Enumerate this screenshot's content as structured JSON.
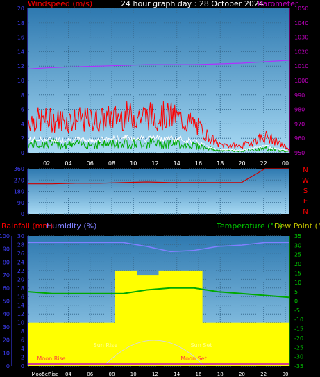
{
  "header": {
    "left_title": "Windspeed (m/s)",
    "center_title": "24 hour graph day : 28 October 2024",
    "right_title": "Barometer (hpa)"
  },
  "x_axis": {
    "ticks": [
      "02",
      "04",
      "06",
      "08",
      "10",
      "12",
      "14",
      "16",
      "18",
      "20",
      "22",
      "00"
    ],
    "bottom_ticks": [
      "Moon",
      "Set",
      "Rise",
      "04",
      "06",
      "08",
      "10",
      "12",
      "14",
      "16",
      "18",
      "20",
      "22",
      "00"
    ]
  },
  "panel_wind": {
    "y_left_ticks": [
      "0",
      "2",
      "4",
      "6",
      "8",
      "10",
      "12",
      "14",
      "16",
      "18",
      "20"
    ],
    "y_right_ticks": [
      "950",
      "960",
      "970",
      "980",
      "990",
      "1000",
      "1010",
      "1020",
      "1030",
      "1040",
      "1050"
    ]
  },
  "panel_dir": {
    "y_left_ticks": [
      "0",
      "90",
      "180",
      "270",
      "360"
    ],
    "compass": [
      "N",
      "W",
      "S",
      "E",
      "N"
    ]
  },
  "panel_temp": {
    "rain_label": "Rainfall (mm)",
    "humidity_label": "Humidity (%)",
    "temp_label": "Temperature (°C)",
    "dew_label": "Dew Point (°C)",
    "humidity_ticks": [
      "0",
      "10",
      "20",
      "30",
      "40",
      "50",
      "60",
      "70",
      "80",
      "90",
      "100"
    ],
    "rain_ticks": [
      "0",
      "2",
      "4",
      "6",
      "8",
      "10",
      "12",
      "14",
      "16",
      "18",
      "20",
      "22",
      "24",
      "26",
      "28",
      "30"
    ],
    "temp_ticks": [
      "-35",
      "-30",
      "-25",
      "-20",
      "-15",
      "-10",
      "-5",
      "0",
      "5",
      "10",
      "15",
      "20",
      "25",
      "30",
      "35"
    ],
    "events": {
      "sun_rise": "Sun Rise",
      "sun_set": "Sun Set",
      "moon_rise": "Moon Rise",
      "moon_set": "Moon Set"
    }
  },
  "colors": {
    "wind_gust": "#ff0000",
    "wind_avg": "#ffffff",
    "wind_green": "#00aa00",
    "barometer": "#b030ff",
    "direction": "#cc0000",
    "humidity": "#8080ff",
    "temperature": "#00aa00",
    "rain": "#ffff00",
    "left_axis": "#4040ff",
    "right_axis": "#c000c0",
    "temp_axis": "#00cc00",
    "label_red": "#ff0000",
    "panel_top": "#2e79b0",
    "panel_bottom": "#a7d9f3"
  },
  "chart_data": [
    {
      "type": "line",
      "title": "24 hour graph day : 28 October 2024",
      "x": [
        "02",
        "04",
        "06",
        "08",
        "10",
        "12",
        "14",
        "16",
        "18",
        "20",
        "22",
        "00"
      ],
      "series": [
        {
          "name": "Windspeed (m/s)",
          "values": [
            4,
            4,
            4,
            4,
            4.5,
            4.5,
            4.5,
            3.5,
            1,
            0.8,
            2,
            0.5
          ]
        },
        {
          "name": "Barometer (hpa)",
          "values": [
            1008,
            1009,
            1009.5,
            1010,
            1010.5,
            1011,
            1011,
            1011,
            1011.5,
            1012,
            1013,
            1014
          ]
        }
      ],
      "ylim_left": [
        0,
        20
      ],
      "ylim_right": [
        950,
        1050
      ]
    },
    {
      "type": "line",
      "x": [
        "02",
        "04",
        "06",
        "08",
        "10",
        "12",
        "14",
        "16",
        "18",
        "20",
        "22",
        "00"
      ],
      "series": [
        {
          "values": [
            240,
            240,
            245,
            245,
            250,
            255,
            250,
            250,
            250,
            250,
            360,
            360
          ]
        }
      ],
      "ylim": [
        0,
        360
      ]
    },
    {
      "type": "area",
      "x": [
        "02",
        "04",
        "06",
        "08",
        "10",
        "12",
        "14",
        "16",
        "18",
        "20",
        "22",
        "00"
      ],
      "series": [
        {
          "name": "Rainfall (mm)",
          "values": [
            10,
            10,
            10,
            10,
            22,
            21,
            22,
            22,
            10,
            10,
            10,
            10
          ]
        },
        {
          "name": "Humidity (%)",
          "values": [
            95,
            95,
            95,
            95,
            95,
            92,
            88,
            89,
            92,
            93,
            95,
            95
          ]
        },
        {
          "name": "Temperature (°C)",
          "values": [
            5,
            4,
            4,
            4,
            4,
            6,
            7,
            7,
            5,
            4,
            3,
            2
          ]
        }
      ],
      "ylim_humidity": [
        0,
        100
      ],
      "ylim_rain": [
        0,
        30
      ],
      "ylim_temp": [
        -35,
        35
      ]
    }
  ]
}
